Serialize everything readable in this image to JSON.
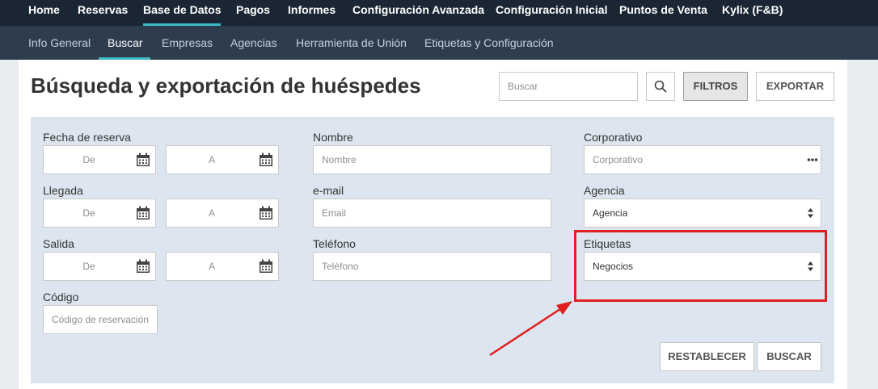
{
  "topnav": {
    "items": [
      "Home",
      "Reservas",
      "Base de Datos",
      "Pagos",
      "Informes",
      "Configuración Avanzada",
      "Configuración Inicial",
      "Puntos de Venta",
      "Kylix (F&B)"
    ],
    "active": "Base de Datos"
  },
  "subnav": {
    "items": [
      "Info General",
      "Buscar",
      "Empresas",
      "Agencias",
      "Herramienta de Unión",
      "Etiquetas y Configuración"
    ],
    "active": "Buscar"
  },
  "header": {
    "title": "Búsqueda y exportación de huéspedes",
    "search_placeholder": "Buscar",
    "filters_label": "FILTROS",
    "export_label": "EXPORTAR"
  },
  "filters": {
    "booking_date": {
      "label": "Fecha de reserva",
      "from_placeholder": "De",
      "to_placeholder": "A"
    },
    "arrival": {
      "label": "Llegada",
      "from_placeholder": "De",
      "to_placeholder": "A"
    },
    "departure": {
      "label": "Salida",
      "from_placeholder": "De",
      "to_placeholder": "A"
    },
    "code": {
      "label": "Código",
      "placeholder": "Código de reservación"
    },
    "name": {
      "label": "Nombre",
      "placeholder": "Nombre"
    },
    "email": {
      "label": "e-mail",
      "placeholder": "Email"
    },
    "phone": {
      "label": "Teléfono",
      "placeholder": "Teléfono"
    },
    "corporate": {
      "label": "Corporativo",
      "placeholder": "Corporativo"
    },
    "agency": {
      "label": "Agencia",
      "value": "Agencia"
    },
    "tags": {
      "label": "Etiquetas",
      "value": "Negocios"
    },
    "reset_label": "RESTABLECER",
    "search_label": "BUSCAR"
  },
  "colors": {
    "topnav_bg": "#1a2633",
    "subnav_bg": "#2e3d4e",
    "accent": "#3bbac4",
    "panel_bg": "#dde6f0",
    "highlight": "#e02020"
  },
  "icons": [
    "search-icon",
    "calendar-icon",
    "dropdown-arrows-icon",
    "ellipsis-icon"
  ]
}
